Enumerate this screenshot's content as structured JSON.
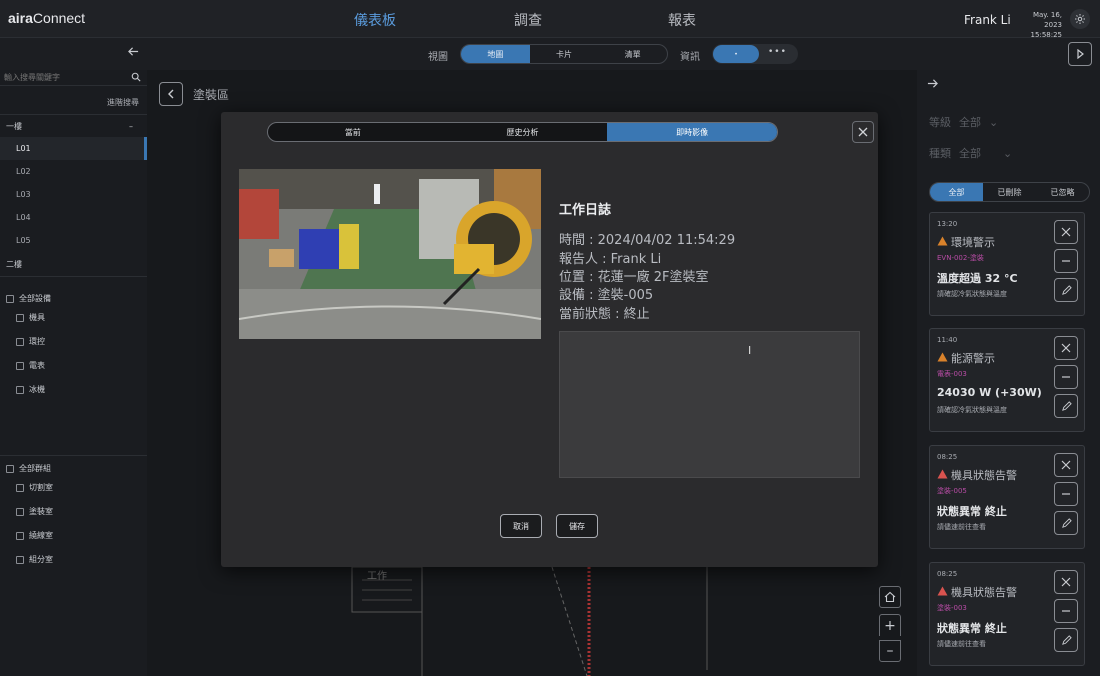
{
  "app": {
    "logo_bold": "aira",
    "logo_rest": "Connect",
    "nav": [
      "儀表板",
      "調查",
      "報表"
    ],
    "active_nav": 0,
    "user_name": "Frank Li",
    "date": "May. 16, 2023",
    "time": "15:58:25"
  },
  "toolbar": {
    "view_label": "視圖",
    "view_options": [
      "地圖",
      "卡片",
      "清單"
    ],
    "active_view": 0,
    "info_label": "資訊",
    "info_dots": "•••"
  },
  "sidebar": {
    "search_placeholder": "輸入搜尋關鍵字",
    "advanced_search": "進階搜尋",
    "floor1": "一樓",
    "floor1_toggle": "–",
    "floor1_items": [
      "L01",
      "L02",
      "L03",
      "L04",
      "L05"
    ],
    "floor2": "二樓",
    "all_devices": "全部設備",
    "device_types": [
      "機具",
      "環控",
      "電表",
      "冰機"
    ],
    "all_groups": "全部群組",
    "groups": [
      "切割室",
      "塗裝室",
      "繞線室",
      "組分室"
    ]
  },
  "map": {
    "area_title": "塗裝區",
    "map_label": "工作",
    "zoom_in": "+",
    "zoom_out": "–"
  },
  "right_panel": {
    "level_label": "等級",
    "level_value": "全部",
    "type_label": "種類",
    "type_value": "全部",
    "tabs": [
      "全部",
      "已刪除",
      "已忽略"
    ],
    "alerts": [
      {
        "time": "13:20",
        "title": "環境警示",
        "device": "EVN-002-塗裝",
        "value": "溫度超過 32 °C",
        "note": "請確認冷氣狀態與溫度",
        "warn_color": "#d9822b"
      },
      {
        "time": "11:40",
        "title": "能源警示",
        "device": "電表-003",
        "value": "24030 W (+30W)",
        "note": "請確認冷氣狀態與溫度",
        "warn_color": "#d9822b"
      },
      {
        "time": "08:25",
        "title": "機具狀態告警",
        "device": "塗裝-005",
        "value": "狀態異常 終止",
        "note": "請儘速前往查看",
        "warn_color": "#d9534f"
      },
      {
        "time": "08:25",
        "title": "機具狀態告警",
        "device": "塗裝-003",
        "value": "狀態異常 終止",
        "note": "請儘速前往查看",
        "warn_color": "#d9534f"
      }
    ]
  },
  "modal": {
    "tabs": [
      "當前",
      "歷史分析",
      "即時影像"
    ],
    "active_tab": 2,
    "log_title": "工作日誌",
    "log_lines": [
      "時間 : 2024/04/02 11:54:29",
      "報告人 : Frank Li",
      "位置 : 花蓮一廠 2F塗裝室",
      "設備 : 塗裝-005",
      "當前狀態 : 終止"
    ],
    "notes_value": "",
    "cancel_label": "取消",
    "save_label": "儲存"
  }
}
